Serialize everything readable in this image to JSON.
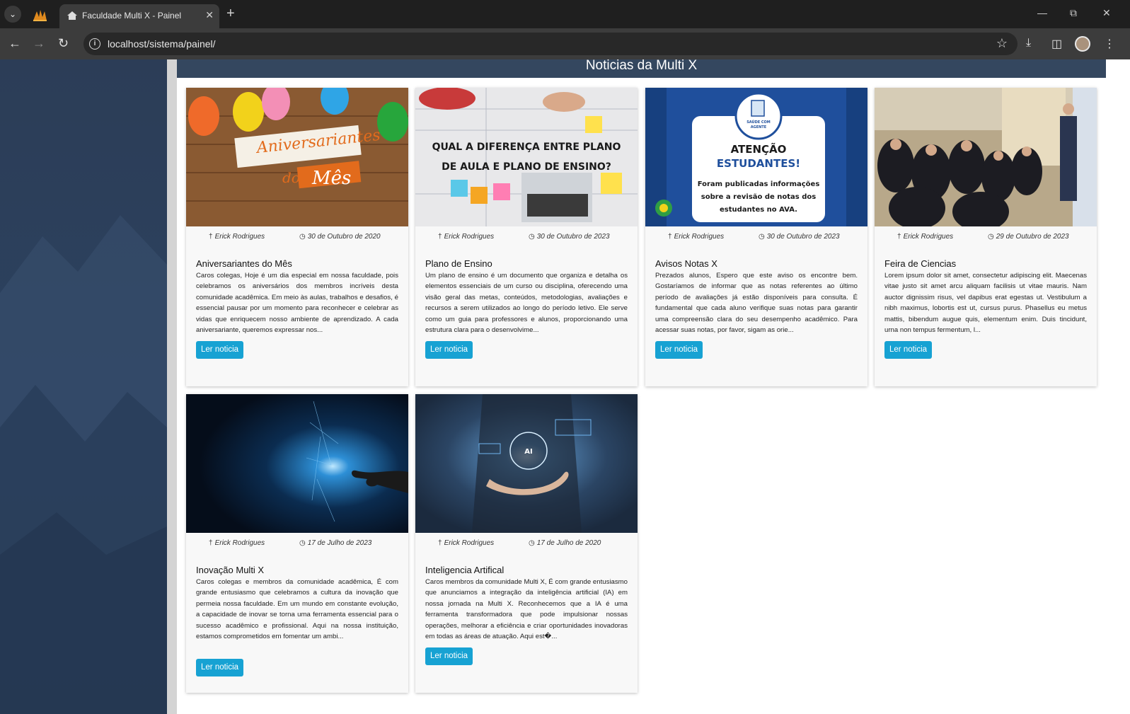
{
  "browser": {
    "tab_title": "Faculdade Multi X - Painel",
    "url": "localhost/sistema/painel/"
  },
  "page": {
    "section_title": "Noticias da Multi X",
    "read_label": "Ler noticia"
  },
  "news": [
    {
      "author": "Erick Rodrigues",
      "date": "30 de Outubro de 2020",
      "title": "Aniversariantes do Mês",
      "excerpt": "Caros colegas, Hoje é um dia especial em nossa faculdade, pois celebramos os aniversários dos membros incríveis desta comunidade acadêmica. Em meio às aulas, trabalhos e desafios, é essencial pausar por um momento para reconhecer e celebrar as vidas que enriquecem nosso ambiente de aprendizado. A cada aniversariante, queremos expressar nos...",
      "image_text": [
        "Aniversariantes",
        "do",
        "Mês"
      ]
    },
    {
      "author": "Erick Rodrigues",
      "date": "30 de Outubro de 2023",
      "title": "Plano de Ensino",
      "excerpt": "Um plano de ensino é um documento que organiza e detalha os elementos essenciais de um curso ou disciplina, oferecendo uma visão geral das metas, conteúdos, metodologias, avaliações e recursos a serem utilizados ao longo do período letivo. Ele serve como um guia para professores e alunos, proporcionando uma estrutura clara para o desenvolvime...",
      "image_text": [
        "QUAL A DIFERENÇA ENTRE PLANO",
        "DE AULA E PLANO DE ENSINO?"
      ]
    },
    {
      "author": "Erick Rodrigues",
      "date": "30 de Outubro de 2023",
      "title": "Avisos Notas X",
      "excerpt": "Prezados alunos, Espero que este aviso os encontre bem. Gostaríamos de informar que as notas referentes ao último período de avaliações já estão disponíveis para consulta. É fundamental que cada aluno verifique suas notas para garantir uma compreensão clara do seu desempenho acadêmico. Para acessar suas notas, por favor, sigam as orie...",
      "image_text": [
        "SAÚDE COM",
        "AGENTE",
        "ATENÇÃO",
        "ESTUDANTES!",
        "Foram publicadas informações",
        "sobre a revisão de notas dos",
        "estudantes no AVA."
      ]
    },
    {
      "author": "Erick Rodrigues",
      "date": "29 de Outubro de 2023",
      "title": "Feira de Ciencias",
      "excerpt": "Lorem ipsum dolor sit amet, consectetur adipiscing elit. Maecenas vitae justo sit amet arcu aliquam facilisis ut vitae mauris. Nam auctor dignissim risus, vel dapibus erat egestas ut. Vestibulum a nibh maximus, lobortis est ut, cursus purus. Phasellus eu metus mattis, bibendum augue quis, elementum enim. Duis tincidunt, urna non tempus fermentum, l...",
      "image_text": []
    },
    {
      "author": "Erick Rodrigues",
      "date": "17 de Julho de 2023",
      "title": "Inovação Multi X",
      "excerpt": "Caros colegas e membros da comunidade acadêmica, É com grande entusiasmo que celebramos a cultura da inovação que permeia nossa faculdade. Em um mundo em constante evolução, a capacidade de inovar se torna uma ferramenta essencial para o sucesso acadêmico e profissional. Aqui na nossa instituição, estamos comprometidos em fomentar um ambi...",
      "image_text": []
    },
    {
      "author": "Erick Rodrigues",
      "date": "17 de Julho de 2020",
      "title": "Inteligencia Artifical",
      "excerpt": "Caros membros da comunidade Multi X, É com grande entusiasmo que anunciamos a integração da inteligência artificial (IA) em nossa jornada na Multi X. Reconhecemos que a IA é uma ferramenta transformadora que pode impulsionar nossas operações, melhorar a eficiência e criar oportunidades inovadoras em todas as áreas de atuação. Aqui est�...",
      "image_text": [
        "AI"
      ]
    }
  ]
}
